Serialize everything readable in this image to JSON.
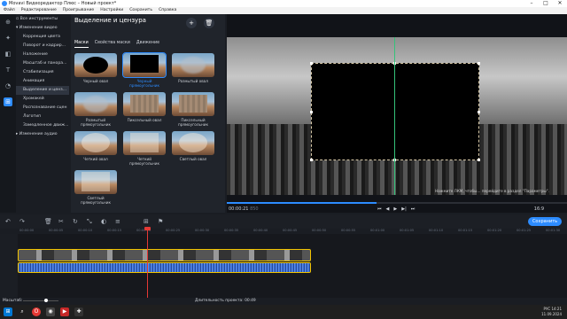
{
  "window": {
    "title": "Movavi Видеоредактор Плюс – Новый проект*",
    "min": "–",
    "max": "□",
    "close": "✕"
  },
  "menu": [
    "Файл",
    "Редактирование",
    "Проигрывание",
    "Настройки",
    "Сохранить",
    "Справка"
  ],
  "rail": [
    "import-icon",
    "magic-icon",
    "filters-icon",
    "titles-icon",
    "transitions-icon",
    "more-tools-icon"
  ],
  "tree": {
    "items": [
      "Все инструменты",
      "Изменение видео",
      "Коррекция цвета",
      "Поворот и кадрир...",
      "Наложение",
      "Масштаб и панора...",
      "Стабилизация",
      "Анимация",
      "Выделение и ценз...",
      "Хромакей",
      "Распознавание сцен",
      "Логотип",
      "Замедленное движ...",
      "Изменение аудио"
    ]
  },
  "panel": {
    "title": "Выделение и цензура",
    "add": "+",
    "delete": "🗑",
    "tabs": [
      "Маски",
      "Свойства маски",
      "Движение"
    ],
    "tiles": [
      {
        "label": "Черный овал",
        "mask": "mask-oval"
      },
      {
        "label": "Черный прямоугольник",
        "mask": "mask-rect"
      },
      {
        "label": "Размытый овал",
        "mask": "blur-oval"
      },
      {
        "label": "Размытый прямоугольник",
        "mask": "blur-oval"
      },
      {
        "label": "Пиксельный овал",
        "mask": "pix-rect"
      },
      {
        "label": "Пиксельный прямоугольник",
        "mask": "pix-rect"
      },
      {
        "label": "Четкий овал",
        "mask": "bright-oval"
      },
      {
        "label": "Четкий прямоугольник",
        "mask": "bright-rect"
      },
      {
        "label": "Светлый овал",
        "mask": "bright-oval"
      },
      {
        "label": "Светлый прямоугольник",
        "mask": "bright-rect"
      }
    ]
  },
  "preview": {
    "hint": "Нажмите ЛКМ, чтобы... перейдите в раздел \"Параметры\".",
    "timecode": "00:00:21",
    "frames": "850",
    "ratio": "16:9",
    "progress": 0.44,
    "controls": [
      "⏮",
      "◀",
      "▶",
      "▶|",
      "⏭"
    ]
  },
  "toolbar": {
    "icons": [
      "↶",
      "↷",
      "🗑",
      "✂",
      "↻",
      "⤡",
      "◐",
      "≡",
      "⊞",
      "⚑"
    ],
    "export": "Сохранить"
  },
  "ruler": [
    "00:00:00",
    "00:00:05",
    "00:00:10",
    "00:00:15",
    "00:00:20",
    "00:00:25",
    "00:00:30",
    "00:00:35",
    "00:00:40",
    "00:00:45",
    "00:00:50",
    "00:00:55",
    "00:01:00",
    "00:01:05",
    "00:01:10",
    "00:01:15",
    "00:01:20",
    "00:01:25",
    "00:01:30"
  ],
  "status": {
    "scale": "Масштаб:",
    "duration": "Длительность проекта: 00:49"
  },
  "taskbar": {
    "time": "14:21",
    "date": "11.09.2024",
    "lang": "РУС"
  }
}
